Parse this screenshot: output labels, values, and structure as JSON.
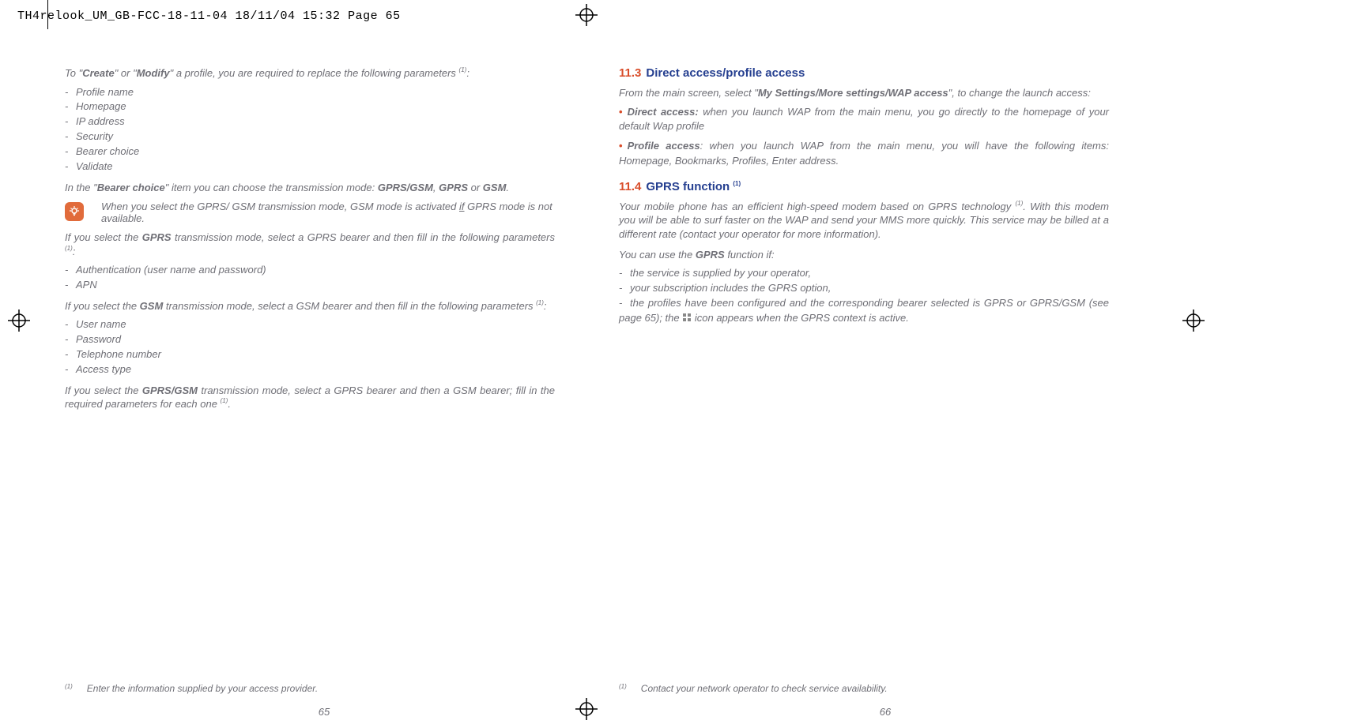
{
  "print_header": "TH4relook_UM_GB-FCC-18-11-04  18/11/04  15:32  Page 65",
  "left": {
    "intro_prefix": "To \"",
    "intro_create": "Create",
    "intro_mid": "\" or \"",
    "intro_modify": "Modify",
    "intro_suffix": "\" a profile, you are required to replace the following parameters ",
    "intro_sup": "(1)",
    "intro_colon": ":",
    "profile_params": [
      "Profile name",
      "Homepage",
      "IP address",
      "Security",
      "Bearer choice",
      "Validate"
    ],
    "bearer_line_prefix": "In the \"",
    "bearer_bold": "Bearer choice",
    "bearer_line_mid": "\" item you can choose the transmission mode: ",
    "bearer_opt1": "GPRS/GSM",
    "bearer_sep1": ", ",
    "bearer_opt2": "GPRS",
    "bearer_sep2": " or ",
    "bearer_opt3": "GSM",
    "bearer_end": ".",
    "tip_text_a": "When you select the GPRS/ GSM transmission mode, GSM mode is activated ",
    "tip_text_if": "if",
    "tip_text_b": " GPRS mode is not available.",
    "gprs_sel_a": "If you select the ",
    "gprs_sel_b": "GPRS",
    "gprs_sel_c": " transmission mode, select a GPRS bearer and then fill in the following parameters ",
    "gprs_sel_sup": "(1)",
    "gprs_sel_colon": ":",
    "gprs_params": [
      "Authentication (user name and password)",
      "APN"
    ],
    "gsm_sel_a": "If you select the ",
    "gsm_sel_b": "GSM",
    "gsm_sel_c": " transmission mode, select a GSM bearer and then fill in the following parameters ",
    "gsm_sel_sup": "(1)",
    "gsm_sel_colon": ":",
    "gsm_params": [
      "User name",
      "Password",
      "Telephone number",
      "Access type"
    ],
    "both_a": "If you select the ",
    "both_b": "GPRS/GSM",
    "both_c": " transmission mode, select a GPRS bearer and then a GSM bearer; fill in the required parameters for each one ",
    "both_sup": "(1)",
    "both_end": ".",
    "footnote_mark": "(1)",
    "footnote_text": "Enter the information supplied by your access provider.",
    "pagenum": "65"
  },
  "right": {
    "h113_num": "11.3",
    "h113_title": "Direct access/profile access",
    "r1_a": "From the main screen, select \"",
    "r1_bold": "My Settings/More settings/WAP access",
    "r1_b": "\", to change the launch access:",
    "bullet1_bold": "Direct access:",
    "bullet1_text": " when you launch WAP from the main menu, you go directly to the homepage of your default Wap profile",
    "bullet2_bold": "Profile access",
    "bullet2_text": ": when you launch WAP from the main menu, you will have the following items: Homepage, Bookmarks, Profiles, Enter address.",
    "h114_num": "11.4",
    "h114_title": "GPRS function ",
    "h114_sup": "(1)",
    "r2_text": "Your mobile phone has an efficient high-speed modem based on GPRS technology ",
    "r2_sup": "(1)",
    "r2_text_b": ". With this modem you will be able to surf faster on the WAP and send your MMS more quickly. This service may be billed at a different rate (contact your operator for more information).",
    "r3_a": "You can use the ",
    "r3_bold": "GPRS",
    "r3_b": " function if:",
    "cond": [
      "the service is supplied by your operator,",
      "your subscription includes the GPRS option,"
    ],
    "cond3_a": "the profiles have been configured and the corresponding bearer selected is GPRS or GPRS/GSM (see page 65); the ",
    "cond3_b": " icon appears when the GPRS context is active.",
    "footnote_mark": "(1)",
    "footnote_text": "Contact your network operator to check service availability.",
    "pagenum": "66"
  }
}
